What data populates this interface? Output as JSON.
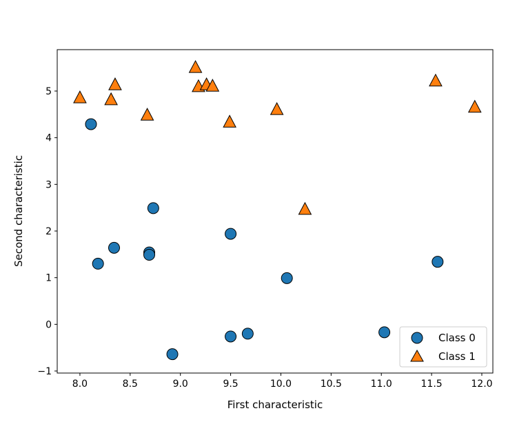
{
  "chart_data": {
    "type": "scatter",
    "title": "",
    "xlabel": "First characteristic",
    "ylabel": "Second characteristic",
    "xlim": [
      7.774,
      12.11
    ],
    "ylim": [
      -1.044,
      5.887
    ],
    "xticks": [
      "8.0",
      "8.5",
      "9.0",
      "9.5",
      "10.0",
      "10.5",
      "11.0",
      "11.5",
      "12.0"
    ],
    "yticks": [
      "-1",
      "0",
      "1",
      "2",
      "3",
      "4",
      "5"
    ],
    "grid": false,
    "legend_position": "lower-right",
    "series": [
      {
        "name": "Class 0",
        "marker": "circle",
        "color": "#1f77b4",
        "points": [
          [
            11.03,
            -0.17
          ],
          [
            8.69,
            1.54
          ],
          [
            8.11,
            4.29
          ],
          [
            9.67,
            -0.2
          ],
          [
            8.69,
            1.49
          ],
          [
            8.92,
            -0.64
          ],
          [
            8.18,
            1.3
          ],
          [
            8.73,
            2.49
          ],
          [
            10.06,
            0.99
          ],
          [
            9.5,
            -0.26
          ],
          [
            8.34,
            1.64
          ],
          [
            9.5,
            1.94
          ],
          [
            11.56,
            1.34
          ]
        ]
      },
      {
        "name": "Class 1",
        "marker": "triangle",
        "color": "#ff7f0e",
        "points": [
          [
            9.96,
            4.6
          ],
          [
            11.54,
            5.21
          ],
          [
            8.31,
            4.81
          ],
          [
            11.93,
            4.65
          ],
          [
            8.35,
            5.13
          ],
          [
            8.67,
            4.48
          ],
          [
            9.18,
            5.09
          ],
          [
            10.24,
            2.46
          ],
          [
            9.49,
            4.33
          ],
          [
            9.26,
            5.13
          ],
          [
            8.0,
            4.85
          ],
          [
            9.32,
            5.1
          ],
          [
            9.15,
            5.5
          ]
        ]
      }
    ]
  }
}
